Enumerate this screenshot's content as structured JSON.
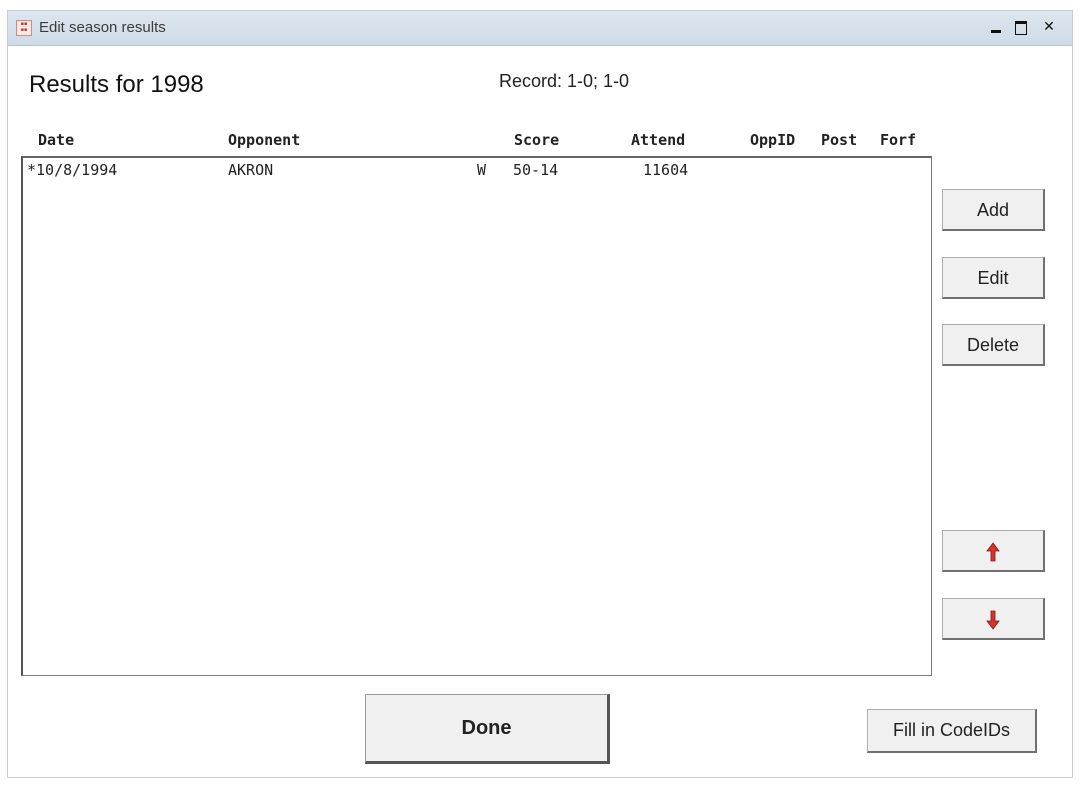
{
  "window": {
    "title": "Edit season results",
    "controls": {
      "minimize": "minimize-icon",
      "maximize": "maximize-icon",
      "close": "close-icon"
    }
  },
  "header": {
    "title": "Results for 1998",
    "record": "Record:  1-0; 1-0"
  },
  "table": {
    "columns": [
      "Date",
      "Opponent",
      "Score",
      "Attend",
      "OppID",
      "Post",
      "Forf"
    ],
    "rows": [
      {
        "date": "*10/8/1994",
        "opponent": "AKRON",
        "result": "W",
        "score": "50-14",
        "attend": "11604",
        "oppid": "",
        "post": "",
        "forf": ""
      }
    ]
  },
  "buttons": {
    "add": "Add",
    "edit": "Edit",
    "delete": "Delete",
    "move_up": "up-arrow-icon",
    "move_down": "down-arrow-icon",
    "done": "Done",
    "fill_codeids": "Fill in CodeIDs"
  },
  "colors": {
    "arrow": "#d9342b",
    "titlebar": "#d6e1ec"
  }
}
